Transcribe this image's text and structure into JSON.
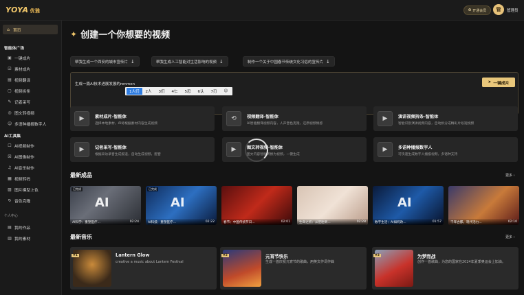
{
  "app": {
    "logo": "YOYA",
    "logo_sub": "优雅"
  },
  "topbar": {
    "vip_label": "开通会员",
    "avatar_initial": "管",
    "user_name": "管理员"
  },
  "sidebar": {
    "home": "首页",
    "section_smart": "智能体广场",
    "smart_items": [
      {
        "icon": "▣",
        "label": "一键成片"
      },
      {
        "icon": "☑",
        "label": "素材成片"
      },
      {
        "icon": "▤",
        "label": "视频翻译"
      },
      {
        "icon": "▢",
        "label": "视频拆条"
      },
      {
        "icon": "✎",
        "label": "记者采写"
      },
      {
        "icon": "◎",
        "label": "图文转视频"
      },
      {
        "icon": "☺",
        "label": "多语种播报数字人"
      }
    ],
    "section_ai": "AI工具集",
    "ai_items": [
      {
        "icon": "☐",
        "label": "AI视频制作"
      },
      {
        "icon": "☒",
        "label": "AI图像制作"
      },
      {
        "icon": "♫",
        "label": "AI音乐制作"
      },
      {
        "icon": "▦",
        "label": "视频转码"
      },
      {
        "icon": "▨",
        "label": "图片模型上色"
      },
      {
        "icon": "↻",
        "label": "音色克隆"
      }
    ],
    "section_personal": "个人中心",
    "personal_items": [
      {
        "icon": "▤",
        "label": "我的作品"
      },
      {
        "icon": "▥",
        "label": "我的素材"
      }
    ]
  },
  "hero": {
    "title": "创建一个你想要的视频"
  },
  "prompt_chips": [
    "帮我生成一个西安的城市宣传片",
    "帮我生成人工智能对生活影响的视频",
    "制作一个关于中国春节传统文化习俗的宣传片"
  ],
  "input": {
    "value": "生成一篇AI技术进展发展的renmen",
    "generate_label": "一键成片"
  },
  "ime_candidates": [
    "1人们",
    "2人",
    "3们",
    "4仁",
    "5忍",
    "6认",
    "7刃"
  ],
  "tools": [
    {
      "name": "素材成片-智能体",
      "desc": "选择本地素材，AI将根据素材内容生成视频"
    },
    {
      "name": "视频翻译-智能体",
      "desc": "AI智能翻译视频内容，人声音色克隆，还原视频情感"
    },
    {
      "name": "演讲视频拆条-智能体",
      "desc": "智能识别演讲视频内容，自动拆分成精彩片段短视频"
    },
    {
      "name": "记者采写-智能体",
      "desc": "根据采访录音生成报道，自动生成视频，配音"
    },
    {
      "name": "图文转视频-智能体",
      "desc": "图文内容智能转换为视频，一键生成"
    },
    {
      "name": "多语种播报数字人",
      "desc": "可快速生成数字人播报视频，多语种支持"
    }
  ],
  "latest_works": {
    "title": "最新成品",
    "more_label": "更多",
    "items": [
      {
        "badge": "已完成",
        "caption": "AI科学：重塑医疗...",
        "duration": "02:24",
        "big": "AI"
      },
      {
        "badge": "已完成",
        "caption": "AI科技：重塑医疗...",
        "duration": "02:22",
        "big": "AI"
      },
      {
        "badge": "",
        "caption": "春节：中国传统节日...",
        "duration": "02:01",
        "big": ""
      },
      {
        "badge": "",
        "caption": "生命之初：从胚胎到...",
        "duration": "02:28",
        "big": ""
      },
      {
        "badge": "",
        "caption": "数字生活：AI如何改...",
        "duration": "01:57",
        "big": "AI"
      },
      {
        "badge": "",
        "caption": "千年古都，现代活力...",
        "duration": "02:10",
        "big": ""
      }
    ]
  },
  "latest_music": {
    "title": "最新音乐",
    "more_label": "更多",
    "items": [
      {
        "num": "#1",
        "title": "Lantern Glow",
        "desc": "creative a music about Lantern Festival"
      },
      {
        "num": "#2",
        "title": "元宵节快乐",
        "desc": "生成一首庆祝元宵节的歌曲，用英文作词作曲"
      },
      {
        "num": "#3",
        "title": "为梦而战",
        "desc": "创作一首歌曲，为您的国家在2024年夏季奥运会上加油。"
      }
    ]
  },
  "colors": {
    "accent": "#e9c77b",
    "bg": "#141414",
    "card": "#262626"
  }
}
